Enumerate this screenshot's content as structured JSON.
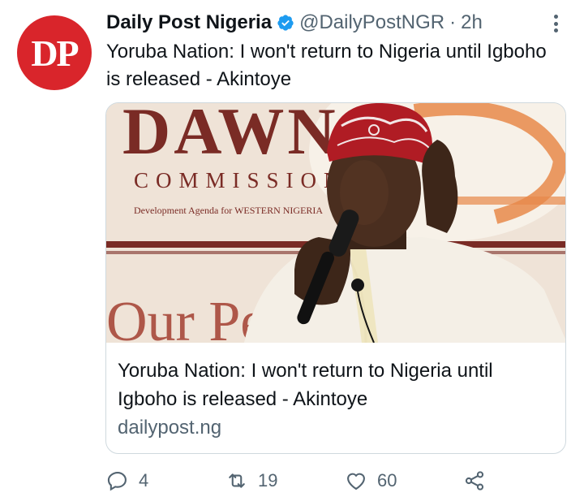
{
  "account": {
    "avatar_text": "DP",
    "name": "Daily Post Nigeria",
    "handle": "@DailyPostNGR",
    "separator": "·",
    "time": "2h"
  },
  "tweet": {
    "text": "Yoruba Nation: I won't return to Nigeria until Igboho is released - Akintoye"
  },
  "card": {
    "title": "Yoruba Nation: I won't return to Nigeria until Igboho is released - Akintoye",
    "domain": "dailypost.ng",
    "banner_word": "DAWN",
    "banner_subtitle": "COMMISSION",
    "banner_tagline": "Development Agenda for WESTERN NIGERIA",
    "banner_fragment": "Our Pe"
  },
  "actions": {
    "replies": "4",
    "retweets": "19",
    "likes": "60"
  },
  "colors": {
    "brand_red": "#d9252b",
    "verified_blue": "#1d9bf0",
    "muted_text": "#536471"
  }
}
